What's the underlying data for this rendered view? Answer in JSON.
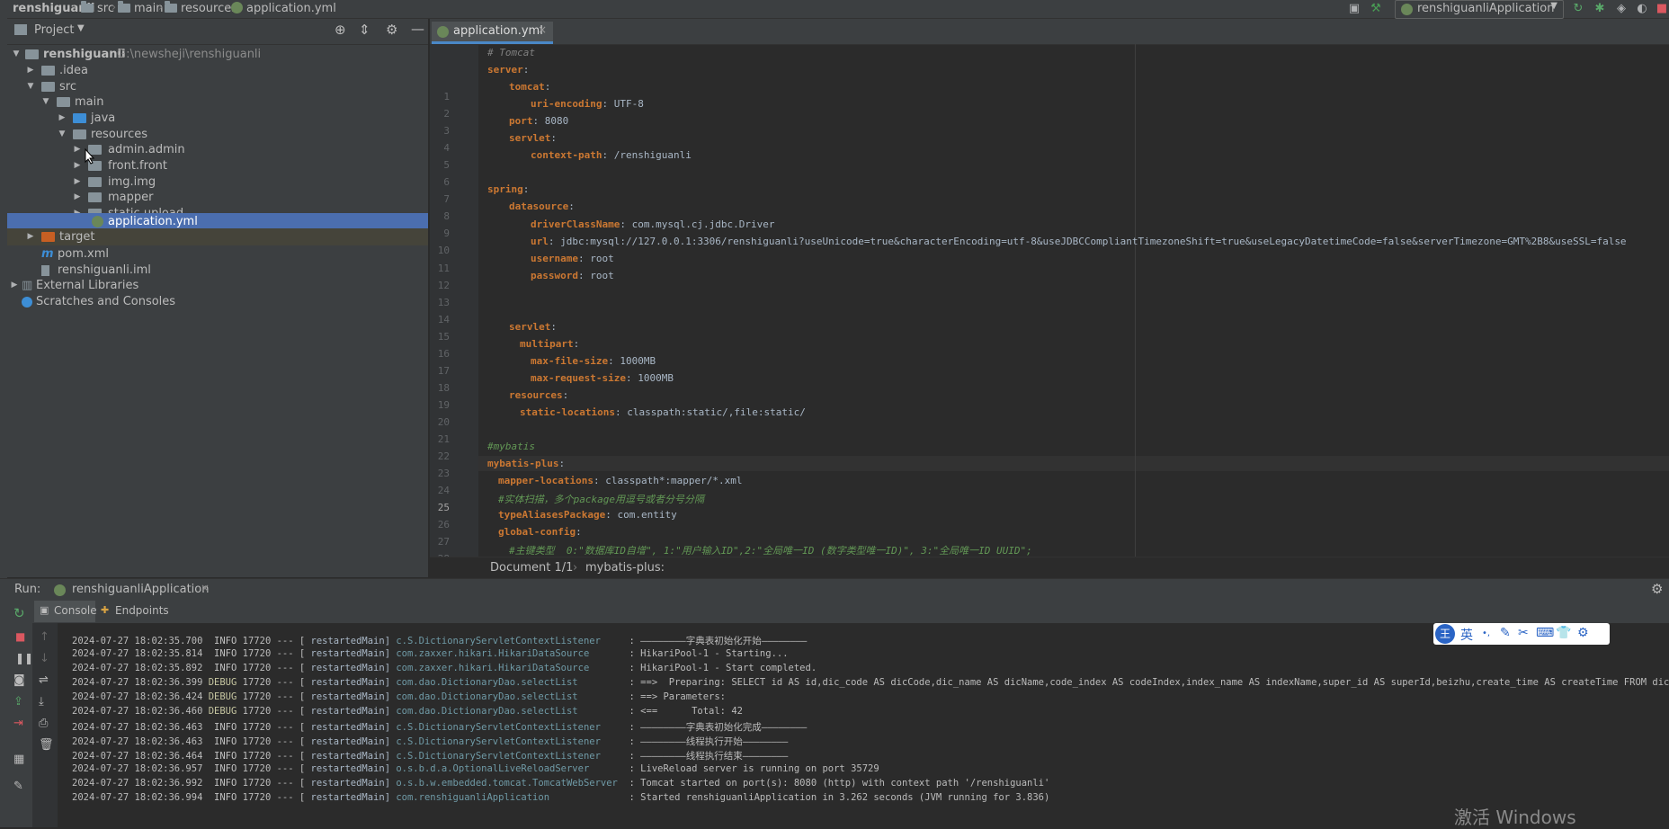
{
  "breadcrumb": {
    "project": "renshiguanli",
    "items": [
      "src",
      "main",
      "resources",
      "application.yml"
    ]
  },
  "toolbar": {
    "run_config": "renshiguanliApplication"
  },
  "project_panel": {
    "title": "Project",
    "root_name": "renshiguanli",
    "root_path": "G:\\newsheji\\renshiguanli",
    "tree": [
      ".idea",
      "src",
      "main",
      "java",
      "resources",
      "admin.admin",
      "front.front",
      "img.img",
      "mapper",
      "static.upload",
      "application.yml",
      "target",
      "pom.xml",
      "renshiguanli.iml",
      "External Libraries",
      "Scratches and Consoles"
    ]
  },
  "editor": {
    "tab": "application.yml",
    "breadcrumb_doc": "Document 1/1",
    "breadcrumb_key": "mybatis-plus:",
    "current_line": 25,
    "lines": [
      "# Tomcat",
      "server:",
      "tomcat:",
      "uri-encoding: UTF-8",
      "port: 8080",
      "servlet:",
      "context-path: /renshiguanli",
      "",
      "spring:",
      "datasource:",
      "driverClassName: com.mysql.cj.jdbc.Driver",
      "url: jdbc:mysql://127.0.0.1:3306/renshiguanli?useUnicode=true&characterEncoding=utf-8&useJDBCCompliantTimezoneShift=true&useLegacyDatetimeCode=false&serverTimezone=GMT%2B8&useSSL=false",
      "username: root",
      "password: root",
      "",
      "",
      "servlet:",
      "multipart:",
      "max-file-size: 1000MB",
      "max-request-size: 1000MB",
      "resources:",
      "static-locations: classpath:static/,file:static/",
      "",
      "#mybatis",
      "mybatis-plus:",
      "mapper-locations: classpath*:mapper/*.xml",
      "#实体扫描，多个package用逗号或者分号分隔",
      "typeAliasesPackage: com.entity",
      "global-config:",
      "#主键类型  0:\"数据库ID自增\", 1:\"用户输入ID\",2:\"全局唯一ID (数字类型唯一ID)\", 3:\"全局唯一ID UUID\";"
    ]
  },
  "run_panel": {
    "label": "Run:",
    "config": "renshiguanliApplication",
    "tabs": [
      "Console",
      "Endpoints"
    ],
    "log": [
      {
        "ts": "2024-07-27 18:02:35.700",
        "lvl": "INFO",
        "pid": "17720",
        "thr": "restartedMain",
        "cls": "c.S.DictionaryServletContextListener",
        "msg": "————————字典表初始化开始————————"
      },
      {
        "ts": "2024-07-27 18:02:35.814",
        "lvl": "INFO",
        "pid": "17720",
        "thr": "restartedMain",
        "cls": "com.zaxxer.hikari.HikariDataSource",
        "msg": "HikariPool-1 - Starting..."
      },
      {
        "ts": "2024-07-27 18:02:35.892",
        "lvl": "INFO",
        "pid": "17720",
        "thr": "restartedMain",
        "cls": "com.zaxxer.hikari.HikariDataSource",
        "msg": "HikariPool-1 - Start completed."
      },
      {
        "ts": "2024-07-27 18:02:36.399",
        "lvl": "DEBUG",
        "pid": "17720",
        "thr": "restartedMain",
        "cls": "com.dao.DictionaryDao.selectList",
        "msg": "==>  Preparing: SELECT id AS id,dic_code AS dicCode,dic_name AS dicName,code_index AS codeIndex,index_name AS indexName,super_id AS superId,beizhu,create_time AS createTime FROM dictionary"
      },
      {
        "ts": "2024-07-27 18:02:36.424",
        "lvl": "DEBUG",
        "pid": "17720",
        "thr": "restartedMain",
        "cls": "com.dao.DictionaryDao.selectList",
        "msg": "==> Parameters: "
      },
      {
        "ts": "2024-07-27 18:02:36.460",
        "lvl": "DEBUG",
        "pid": "17720",
        "thr": "restartedMain",
        "cls": "com.dao.DictionaryDao.selectList",
        "msg": "<==      Total: 42"
      },
      {
        "ts": "2024-07-27 18:02:36.463",
        "lvl": "INFO",
        "pid": "17720",
        "thr": "restartedMain",
        "cls": "c.S.DictionaryServletContextListener",
        "msg": "————————字典表初始化完成————————"
      },
      {
        "ts": "2024-07-27 18:02:36.463",
        "lvl": "INFO",
        "pid": "17720",
        "thr": "restartedMain",
        "cls": "c.S.DictionaryServletContextListener",
        "msg": "————————线程执行开始————————"
      },
      {
        "ts": "2024-07-27 18:02:36.464",
        "lvl": "INFO",
        "pid": "17720",
        "thr": "restartedMain",
        "cls": "c.S.DictionaryServletContextListener",
        "msg": "————————线程执行结束————————"
      },
      {
        "ts": "2024-07-27 18:02:36.957",
        "lvl": "INFO",
        "pid": "17720",
        "thr": "restartedMain",
        "cls": "o.s.b.d.a.OptionalLiveReloadServer",
        "msg": "LiveReload server is running on port 35729"
      },
      {
        "ts": "2024-07-27 18:02:36.992",
        "lvl": "INFO",
        "pid": "17720",
        "thr": "restartedMain",
        "cls": "o.s.b.w.embedded.tomcat.TomcatWebServer",
        "msg": "Tomcat started on port(s): 8080 (http) with context path '/renshiguanli'"
      },
      {
        "ts": "2024-07-27 18:02:36.994",
        "lvl": "INFO",
        "pid": "17720",
        "thr": "restartedMain",
        "cls": "com.renshiguanliApplication",
        "msg": "Started renshiguanliApplication in 3.262 seconds (JVM running for 3.836)"
      }
    ]
  },
  "ime": {
    "mode_char": "英"
  },
  "watermark": "激活 Windows",
  "colors": {
    "accent": "#4b6eaf",
    "keyword": "#cc7832",
    "comment": "#629755",
    "bg": "#2b2b2b"
  }
}
